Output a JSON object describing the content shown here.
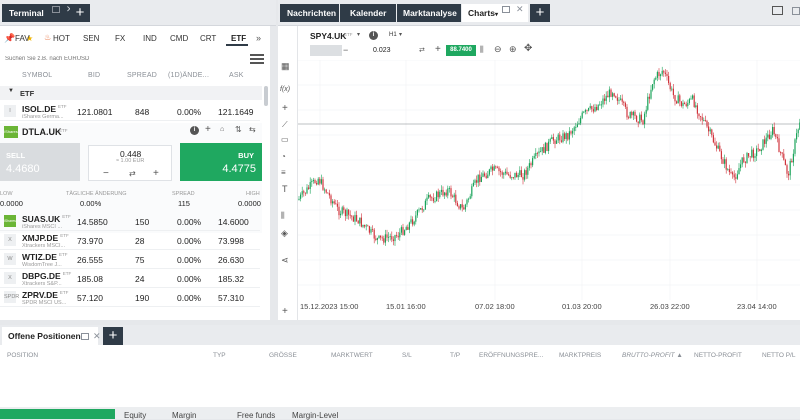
{
  "terminal": {
    "title": "Terminal"
  },
  "nav_tabs": [
    "Nachrichten",
    "Kalender",
    "Marktanalyse",
    "Charts"
  ],
  "categories": [
    "FAV",
    "HOT",
    "SEN",
    "FX",
    "IND",
    "CMD",
    "CRT",
    "ETF"
  ],
  "categories_more": "»",
  "search": {
    "placeholder": "Suchen Sie z.B. nach EURUSD"
  },
  "table_headers": {
    "symbol": "SYMBOL",
    "bid": "BID",
    "spread": "SPREAD",
    "change": "(1D)ÄNDE...",
    "ask": "ASK"
  },
  "group": {
    "label": "ETF"
  },
  "rows_top": [
    {
      "icon": "I",
      "symbol": "ISOL.DE",
      "badge": "ETF",
      "desc": "iShares Germa...",
      "bid": "121.0801",
      "spread": "848",
      "change": "0.00%",
      "ask": "121.1649"
    }
  ],
  "selected": {
    "symbol": "DTLA.UK",
    "badge": "ETF",
    "icon": "iShares",
    "sell_label": "SELL",
    "sell_price": "4.4680",
    "qty": "0.448",
    "qty_note": "≈ 1.00 EUR",
    "buy_label": "BUY",
    "buy_price": "4.4775",
    "stats_labels": {
      "low": "LOW",
      "change": "TÄGLICHE ÄNDERUNG",
      "spread": "SPREAD",
      "high": "HIGH"
    },
    "stats_values": {
      "low": "0.0000",
      "change": "0.00%",
      "spread": "115",
      "high": "0.0000"
    }
  },
  "rows_bottom": [
    {
      "icon": "iShares",
      "symbol": "SUAS.UK",
      "badge": "ETF",
      "desc": "iShares MSCI ...",
      "bid": "14.5850",
      "spread": "150",
      "change": "0.00%",
      "ask": "14.6000"
    },
    {
      "icon": "X",
      "symbol": "XMJP.DE",
      "badge": "ETF",
      "desc": "Xtrackers MSCI...",
      "bid": "73.970",
      "spread": "28",
      "change": "0.00%",
      "ask": "73.998"
    },
    {
      "icon": "W",
      "symbol": "WTIZ.DE",
      "badge": "ETF",
      "desc": "WisdomTree J...",
      "bid": "26.555",
      "spread": "75",
      "change": "0.00%",
      "ask": "26.630"
    },
    {
      "icon": "X",
      "symbol": "DBPG.DE",
      "badge": "ETF",
      "desc": "Xtrackers S&P...",
      "bid": "185.08",
      "spread": "24",
      "change": "0.00%",
      "ask": "185.32"
    },
    {
      "icon": "SPDR",
      "symbol": "ZPRV.DE",
      "badge": "ETF",
      "desc": "SPDR MSCI US...",
      "bid": "57.120",
      "spread": "190",
      "change": "0.00%",
      "ask": "57.310"
    }
  ],
  "chart_toolbar": {
    "symbol": "SPY4.UK",
    "badge": "ETF",
    "interval": "H1",
    "qty": "0.023",
    "sell_price": "",
    "buy_price": "88.7400"
  },
  "chart_data": {
    "type": "line",
    "series": [
      {
        "values": []
      }
    ],
    "x_tick_labels": [
      "15.12.2023 15:00",
      "15.01 16:00",
      "07.02 18:00",
      "01.03 20:00",
      "26.03 22:00",
      "23.04 14:00"
    ],
    "colors": {
      "up": "#1aa35a",
      "down": "#d0343c"
    }
  },
  "positions": {
    "title": "Offene Positionen",
    "headers": [
      "POSITION",
      "TYP",
      "GRÖSSE",
      "MARKTWERT",
      "S/L",
      "T/P",
      "ERÖFFNUNGSPRE...",
      "MARKTPREIS",
      "BRUTTO-PROFIT ▲",
      "NETTO-PROFIT",
      "NETTO P/L"
    ]
  },
  "footer": {
    "equity": "Equity",
    "margin": "Margin",
    "free_funds": "Free funds",
    "margin_level": "Margin-Level"
  }
}
